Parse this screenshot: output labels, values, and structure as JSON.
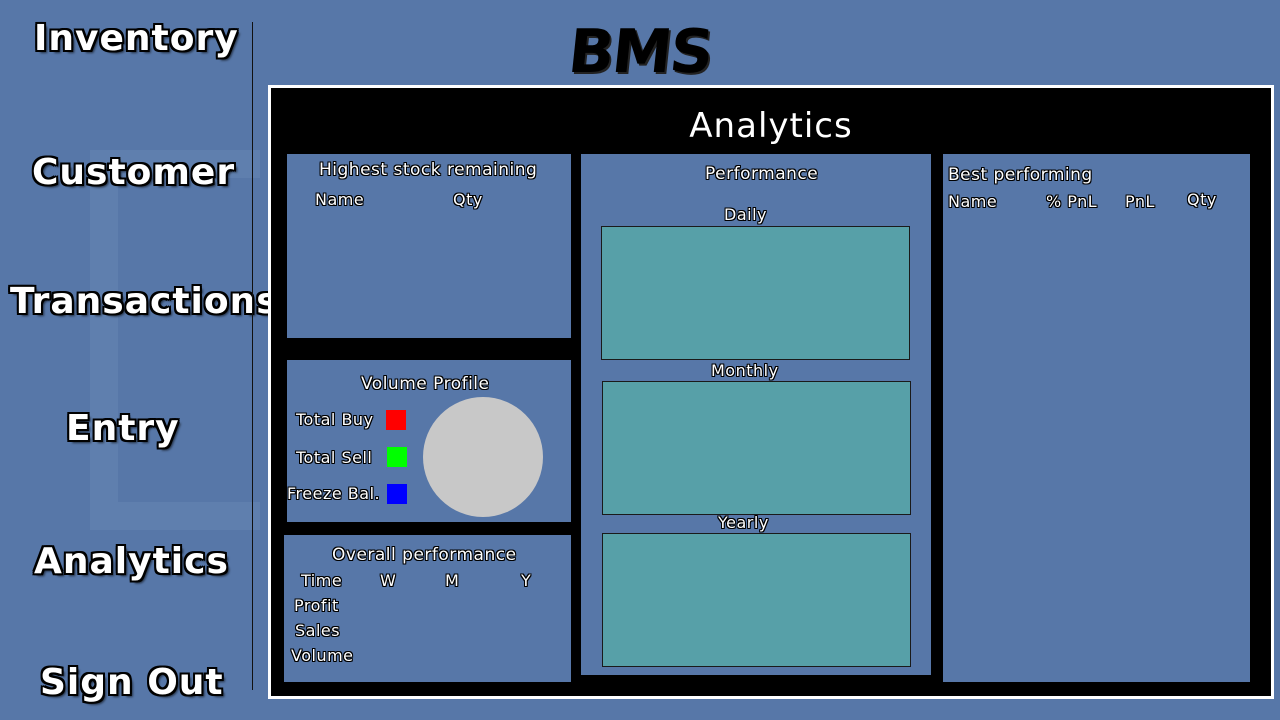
{
  "app": {
    "logo_text": "BMS"
  },
  "sidebar": {
    "items": [
      {
        "label": "Inventory"
      },
      {
        "label": "Customer"
      },
      {
        "label": "Transactions"
      },
      {
        "label": "Entry"
      },
      {
        "label": "Analytics"
      },
      {
        "label": "Sign Out"
      }
    ]
  },
  "main": {
    "title": "Analytics",
    "stock_panel": {
      "title": "Highest stock remaining",
      "columns": [
        "Name",
        "Qty"
      ]
    },
    "volume_panel": {
      "title": "Volume  Profile",
      "legend": [
        {
          "label": "Total Buy",
          "color": "#ff0000"
        },
        {
          "label": "Total Sell",
          "color": "#00ff00"
        },
        {
          "label": "Freeze Bal.",
          "color": "#0000ff"
        }
      ],
      "pie_color": "#c8c8c8"
    },
    "overall_panel": {
      "title": "Overall performance",
      "columns": [
        "Time",
        "W",
        "M",
        "Y"
      ],
      "rows": [
        "Profit",
        "Sales",
        "Volume"
      ]
    },
    "performance_panel": {
      "title": "Performance",
      "charts": [
        {
          "label": "Daily"
        },
        {
          "label": "Monthly"
        },
        {
          "label": "Yearly"
        }
      ]
    },
    "best_panel": {
      "title": "Best performing",
      "columns": [
        "Name",
        "% PnL",
        "PnL",
        "Qty"
      ]
    }
  },
  "colors": {
    "background": "#5777a8",
    "chart_fill": "#57a0a8",
    "frame": "#000000"
  }
}
